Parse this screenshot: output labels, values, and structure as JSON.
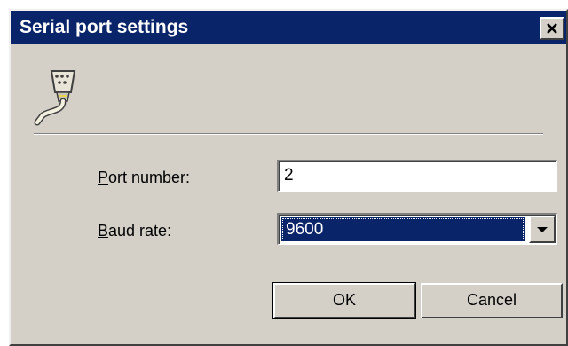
{
  "window": {
    "title": "Serial port settings"
  },
  "form": {
    "port_label_accel": "P",
    "port_label_rest": "ort number:",
    "port_value": "2",
    "baud_label_accel": "B",
    "baud_label_rest": "aud rate:",
    "baud_selected": "9600"
  },
  "buttons": {
    "ok": "OK",
    "cancel": "Cancel"
  },
  "icons": {
    "app": "serial-connector-icon",
    "close": "close-icon",
    "dropdown": "dropdown-arrow-icon"
  },
  "colors": {
    "titlebar": "#0a246a",
    "dialog_bg": "#d4d0c8",
    "selection": "#0a246a"
  }
}
